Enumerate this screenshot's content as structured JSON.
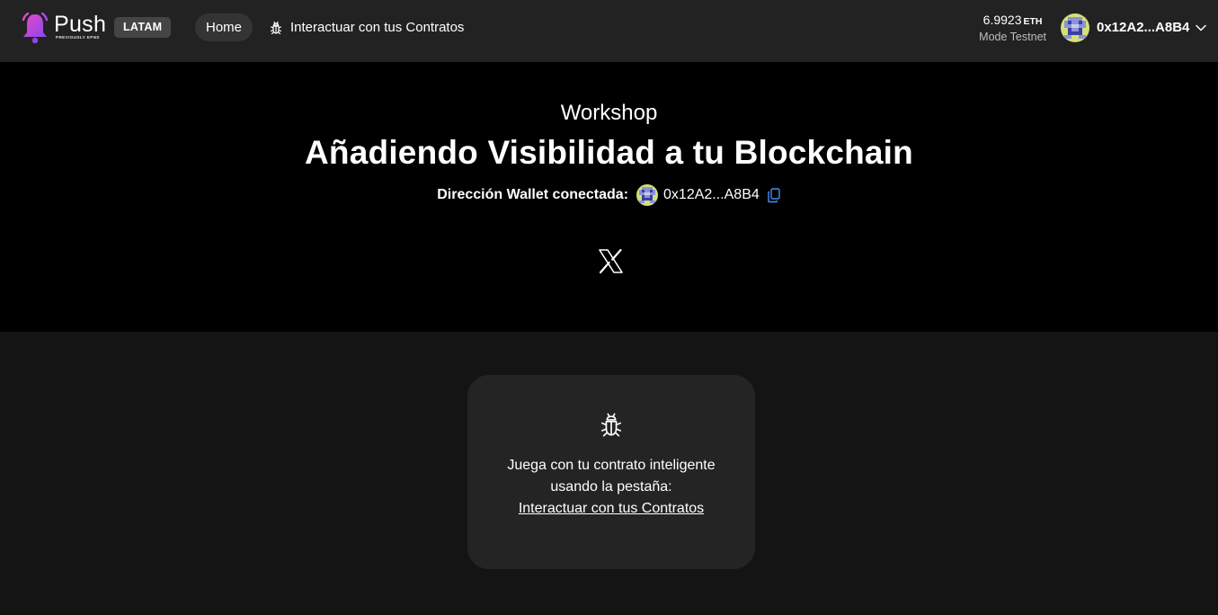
{
  "header": {
    "logo_word": "Push",
    "logo_subtitle": "PREVIOUSLY EPNS",
    "badge": "LATAM",
    "nav": {
      "home": "Home",
      "contracts": "Interactuar con tus Contratos"
    },
    "balance": {
      "amount": "6.9923",
      "unit": "ETH",
      "network": "Mode Testnet"
    },
    "account": {
      "address": "0x12A2...A8B4"
    }
  },
  "hero": {
    "kicker": "Workshop",
    "title": "Añadiendo Visibilidad a tu Blockchain",
    "wallet_label": "Dirección Wallet conectada:",
    "wallet_address": "0x12A2...A8B4"
  },
  "card": {
    "line1": "Juega con tu contrato inteligente",
    "line2": "usando la pestaña:",
    "link": "Interactuar con tus Contratos"
  },
  "icons": {
    "logo": "push-bell-logo",
    "nav_contracts": "bug-icon",
    "account_avatar": "blockie-avatar",
    "account_menu": "chevron-down-icon",
    "copy": "copy-icon",
    "social": "x-logo-icon",
    "card": "bug-icon"
  },
  "colors": {
    "topbar": "#222222",
    "hero": "#000000",
    "page": "#141414",
    "card": "#242424",
    "badge": "#454545",
    "logo_pink": "#e64ac4",
    "logo_purple": "#8d46ef",
    "copy_icon": "#4a8af4"
  }
}
